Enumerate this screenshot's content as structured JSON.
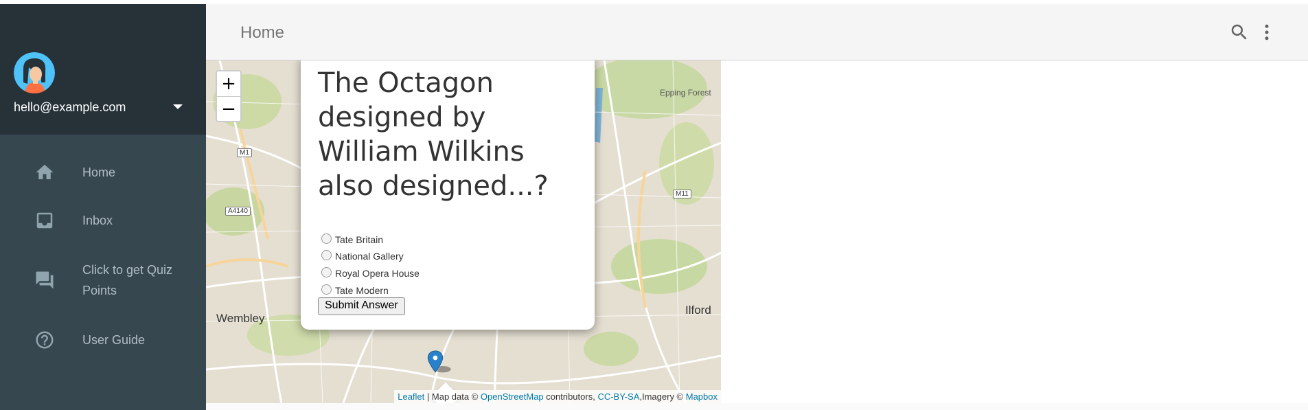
{
  "header": {
    "title": "Home"
  },
  "sidebar": {
    "email": "hello@example.com",
    "items": [
      {
        "label": "Home",
        "icon": "home-icon"
      },
      {
        "label": "Inbox",
        "icon": "inbox-icon"
      },
      {
        "label": "Click to get Quiz Points",
        "icon": "chat-icon"
      },
      {
        "label": "User Guide",
        "icon": "help-icon"
      }
    ]
  },
  "map": {
    "zoom_in": "+",
    "zoom_out": "−",
    "labels": {
      "epping": "Epping Forest",
      "wembley": "Wembley",
      "ilford": "Ilford",
      "m1": "M1",
      "m11": "M11",
      "a4140": "A4140"
    },
    "attribution": {
      "leaflet": "Leaflet",
      "sep1": " | Map data © ",
      "osm": "OpenStreetMap",
      "sep2": " contributors, ",
      "cc": "CC-BY-SA",
      "sep3": ",Imagery © ",
      "mapbox": "Mapbox"
    }
  },
  "popup": {
    "question": "The Octagon designed by William Wilkins also designed...?",
    "options": [
      "Tate Britain",
      "National Gallery",
      "Royal Opera House",
      "Tate Modern"
    ],
    "submit_label": "Submit Answer"
  },
  "colors": {
    "sidebar_bg": "#37474f",
    "profile_bg": "#263238",
    "header_bg": "#f5f5f5",
    "marker": "#2a81cb"
  }
}
